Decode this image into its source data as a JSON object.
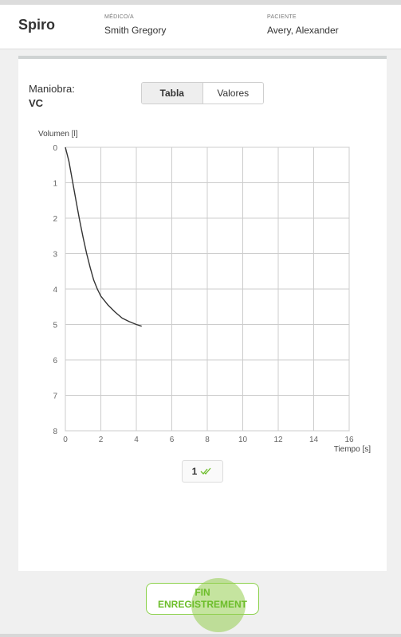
{
  "header": {
    "app_title": "Spiro",
    "medico_label": "MÉDICO/A",
    "medico_value": "Smith Gregory",
    "paciente_label": "PACIENTE",
    "paciente_value": "Avery, Alexander"
  },
  "maneuver": {
    "label": "Maniobra:",
    "value": "VC"
  },
  "view_toggle": {
    "options": [
      "Tabla",
      "Valores"
    ],
    "selected": "Tabla"
  },
  "chart_data": {
    "type": "line",
    "ylabel": "Volumen [l]",
    "xlabel": "Tiempo [s]",
    "xlim": [
      0,
      16
    ],
    "ylim": [
      0,
      8
    ],
    "y_inverted": true,
    "x_ticks": [
      "0",
      "2",
      "4",
      "6",
      "8",
      "10",
      "12",
      "14",
      "16"
    ],
    "y_ticks": [
      "0",
      "1",
      "2",
      "3",
      "4",
      "5",
      "6",
      "7",
      "8"
    ],
    "grid": true,
    "series": [
      {
        "x": [
          0,
          0.2,
          0.4,
          0.6,
          0.8,
          1.0,
          1.2,
          1.4,
          1.6,
          1.8,
          2.0,
          2.4,
          2.8,
          3.2,
          3.6,
          4.0,
          4.3
        ],
        "y": [
          0,
          0.4,
          0.95,
          1.5,
          2.05,
          2.55,
          3.0,
          3.4,
          3.75,
          4.0,
          4.2,
          4.45,
          4.65,
          4.82,
          4.92,
          5.0,
          5.05
        ]
      }
    ]
  },
  "trial": {
    "number": "1",
    "check_color": "#6cbd2a"
  },
  "footer": {
    "fin_label_line1": "FIN",
    "fin_label_line2": "ENREGISTREMENT"
  },
  "colors": {
    "accent_green": "#8bd14a",
    "curve": "#333333"
  }
}
